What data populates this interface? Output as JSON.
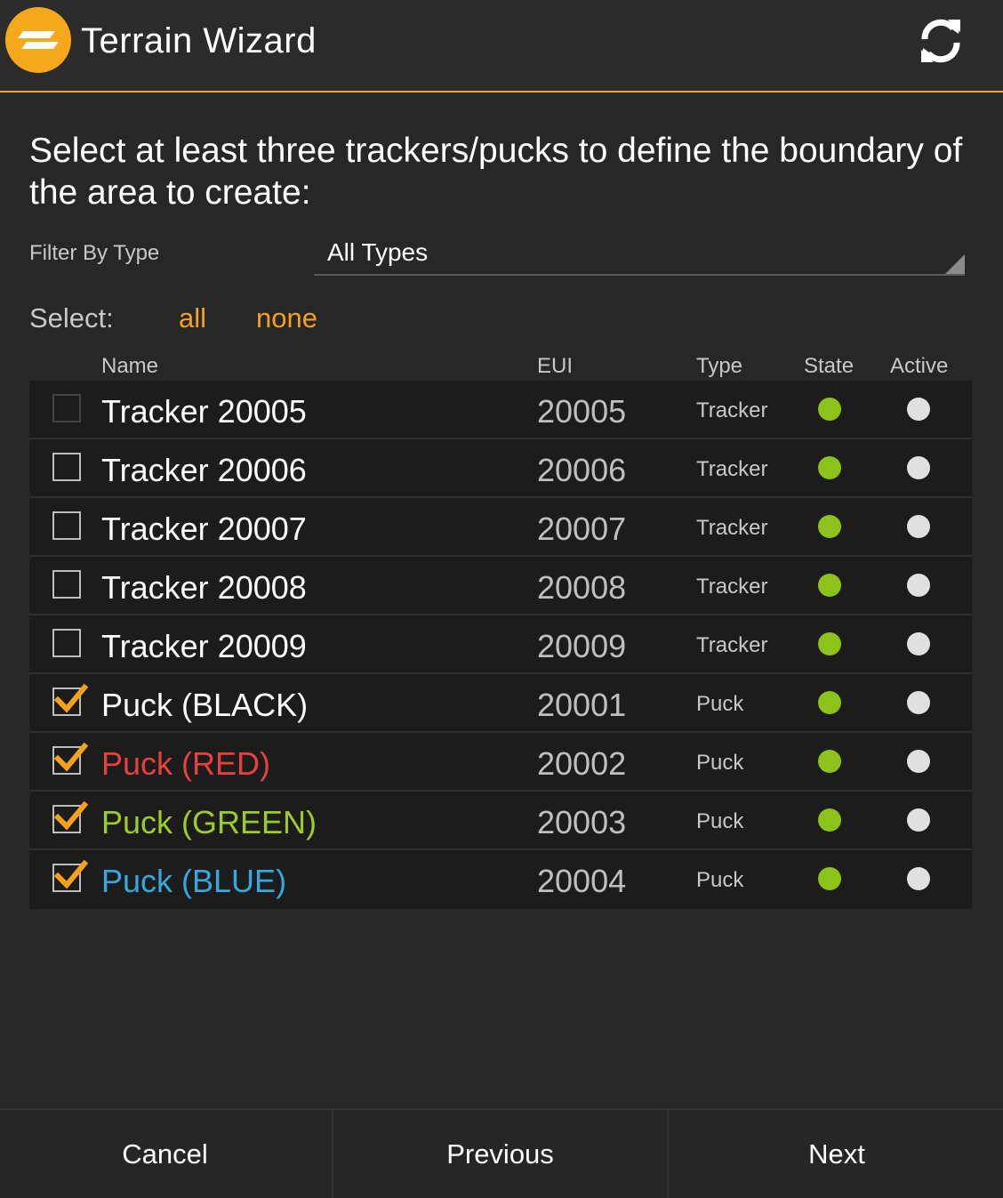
{
  "header": {
    "title": "Terrain Wizard",
    "logo_icon": "terrain-logo-icon",
    "refresh_icon": "refresh-icon"
  },
  "instructions": "Select at least three trackers/pucks to define the boundary of the area to create:",
  "filter": {
    "label": "Filter By Type",
    "value": "All Types"
  },
  "select": {
    "label": "Select:",
    "all": "all",
    "none": "none"
  },
  "table": {
    "columns": [
      "Name",
      "EUI",
      "Type",
      "State",
      "Active"
    ],
    "rows": [
      {
        "checked": false,
        "name": "Tracker 20005",
        "eui": "20005",
        "type": "Tracker",
        "name_color": "#ffffff",
        "state_color": "#8cc21a",
        "active_color": "#e0e0e0"
      },
      {
        "checked": false,
        "name": "Tracker 20006",
        "eui": "20006",
        "type": "Tracker",
        "name_color": "#ffffff",
        "state_color": "#8cc21a",
        "active_color": "#e0e0e0"
      },
      {
        "checked": false,
        "name": "Tracker 20007",
        "eui": "20007",
        "type": "Tracker",
        "name_color": "#ffffff",
        "state_color": "#8cc21a",
        "active_color": "#e0e0e0"
      },
      {
        "checked": false,
        "name": "Tracker 20008",
        "eui": "20008",
        "type": "Tracker",
        "name_color": "#ffffff",
        "state_color": "#8cc21a",
        "active_color": "#e0e0e0"
      },
      {
        "checked": false,
        "name": "Tracker 20009",
        "eui": "20009",
        "type": "Tracker",
        "name_color": "#ffffff",
        "state_color": "#8cc21a",
        "active_color": "#e0e0e0"
      },
      {
        "checked": true,
        "name": "Puck (BLACK)",
        "eui": "20001",
        "type": "Puck",
        "name_color": "#ffffff",
        "state_color": "#8cc21a",
        "active_color": "#e0e0e0"
      },
      {
        "checked": true,
        "name": "Puck (RED)",
        "eui": "20002",
        "type": "Puck",
        "name_color": "#e8413c",
        "state_color": "#8cc21a",
        "active_color": "#e0e0e0"
      },
      {
        "checked": true,
        "name": "Puck (GREEN)",
        "eui": "20003",
        "type": "Puck",
        "name_color": "#9ccc2a",
        "state_color": "#8cc21a",
        "active_color": "#e0e0e0"
      },
      {
        "checked": true,
        "name": "Puck (BLUE)",
        "eui": "20004",
        "type": "Puck",
        "name_color": "#35a8e0",
        "state_color": "#8cc21a",
        "active_color": "#e0e0e0"
      }
    ]
  },
  "footer": {
    "cancel": "Cancel",
    "previous": "Previous",
    "next": "Next"
  },
  "colors": {
    "accent": "#f4a11c",
    "background": "#272727",
    "table_bg": "#1c1c1c"
  }
}
